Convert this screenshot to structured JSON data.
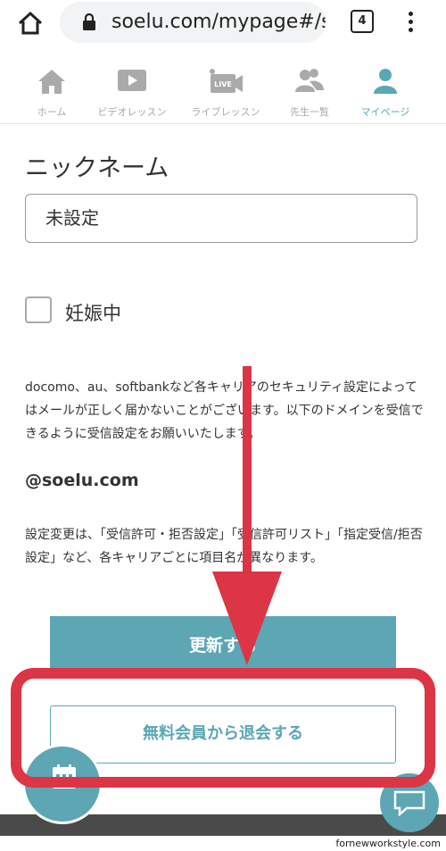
{
  "browser": {
    "url": "soelu.com/mypage#/settings",
    "tab_count": "4"
  },
  "nav": {
    "items": [
      {
        "label": "ホーム",
        "icon": "home-icon",
        "active": false
      },
      {
        "label": "ビデオレッスン",
        "icon": "video-play-icon",
        "active": false
      },
      {
        "label": "ライブレッスン",
        "icon": "live-camera-icon",
        "active": false
      },
      {
        "label": "先生一覧",
        "icon": "teachers-icon",
        "active": false
      },
      {
        "label": "マイページ",
        "icon": "user-icon",
        "active": true
      }
    ]
  },
  "form": {
    "nickname_label": "ニックネーム",
    "nickname_value": "未設定",
    "pregnant_label": "妊娠中",
    "pregnant_checked": false
  },
  "notice": {
    "text": "docomo、au、softbankなど各キャリアのセキュリティ設定によってはメールが正しく届かないことがございます。以下のドメインを受信できるように受信設定をお願いいたします。",
    "domain": "@soelu.com",
    "text2": "設定変更は、「受信許可・拒否設定」「受信許可リスト」「指定受信/拒否設定」など、各キャリアごとに項目名が異なります。"
  },
  "buttons": {
    "update": "更新する",
    "withdraw": "無料会員から退会する"
  },
  "watermark": "fornewworkstyle.com",
  "colors": {
    "accent": "#5da6b3",
    "annotation": "#dc3545",
    "footer": "#4a4a4a"
  }
}
